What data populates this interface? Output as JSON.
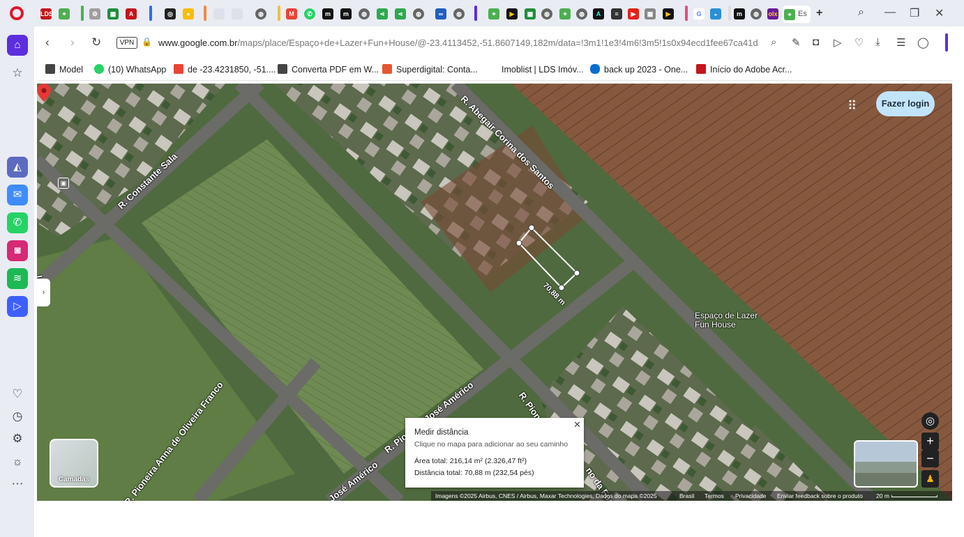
{
  "browser": {
    "url_domain": "www.google.com.br",
    "url_path": "/maps/place/Espaço+de+Lazer+Fun+House/@-23.4113452,-51.8607149,182m/data=!3m1!1e3!4m6!3m5!1s0x94ecd1fee67ca41d:0",
    "vpn_label": "VPN",
    "active_tab_label": "Es",
    "bookmarks": [
      {
        "label": "Model",
        "icon": "folder-icon",
        "color": "#444444"
      },
      {
        "label": "(10) WhatsApp",
        "icon": "whatsapp-icon",
        "color": "#25d366"
      },
      {
        "label": "de -23.4231850, -51....",
        "icon": "maps-icon",
        "color": "#ea4335"
      },
      {
        "label": "Converta PDF em W...",
        "icon": "folder-icon",
        "color": "#444444"
      },
      {
        "label": "Superdigital: Conta...",
        "icon": "superdigital-icon",
        "color": "#e4572e"
      },
      {
        "label": "Imoblist | LDS Imóv...",
        "icon": "blank-icon",
        "color": "#ffffff"
      },
      {
        "label": "back up 2023 - One...",
        "icon": "onedrive-icon",
        "color": "#0a6ed1"
      },
      {
        "label": "Início do Adobe Acr...",
        "icon": "adobe-icon",
        "color": "#c4161c"
      }
    ]
  },
  "map": {
    "road_labels": {
      "abegair": "R. Abegair Corina dos Santos",
      "constante": "R. Constante Sala",
      "pioneiro_jose_1": "R. Pioneiro José Américo",
      "pioneiro_jose_2": "José Américo",
      "pioneira_anna": "R. Pioneira Anna de Oliveira Franco",
      "pione": "R. Pione",
      "fonc": "no da Fonc",
      "la": "la"
    },
    "place_name_line1": "Espaço de Lazer",
    "place_name_line2": "Fun House",
    "measurement_label": "70,88 m",
    "login_label": "Fazer login",
    "layers_label": "Camadas",
    "measure_panel": {
      "title": "Medir distância",
      "subtitle": "Clique no mapa para adicionar ao seu caminho",
      "area": "Área total: 216,14 m² (2.326,47 ft²)",
      "distance": "Distância total: 70,88 m (232,54 pés)"
    },
    "attribution": {
      "imagery": "Imagens ©2025 Airbus, CNES / Airbus, Maxar Technologies, Dados do mapa ©2025",
      "country": "Brasil",
      "terms": "Termos",
      "privacy": "Privacidade",
      "feedback": "Enviar feedback sobre o produto",
      "scale": "20 m"
    }
  },
  "colors": {
    "opera_red": "#e0172b",
    "sidebar_active": "#5b2ee0",
    "pin": "#e53935",
    "login_bg": "#c2e4fb"
  }
}
